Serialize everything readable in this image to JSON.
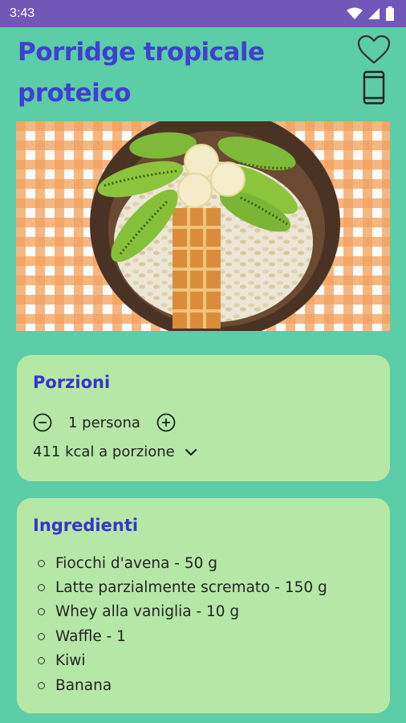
{
  "status_bar": {
    "time": "3:43"
  },
  "recipe": {
    "title": "Porridge tropicale proteico"
  },
  "portions": {
    "title": "Porzioni",
    "value": "1 persona",
    "kcal": "411 kcal a porzione"
  },
  "ingredients": {
    "title": "Ingredienti",
    "items": [
      "Fiocchi d'avena - 50 g",
      "Latte parzialmente scremato - 150 g",
      "Whey alla vaniglia - 10 g",
      "Waffle - 1",
      "Kiwi",
      "Banana"
    ]
  },
  "colors": {
    "background": "#5ccda6",
    "status_bar": "#7158b8",
    "title": "#3f3fd0",
    "card": "#b5e8a6"
  }
}
